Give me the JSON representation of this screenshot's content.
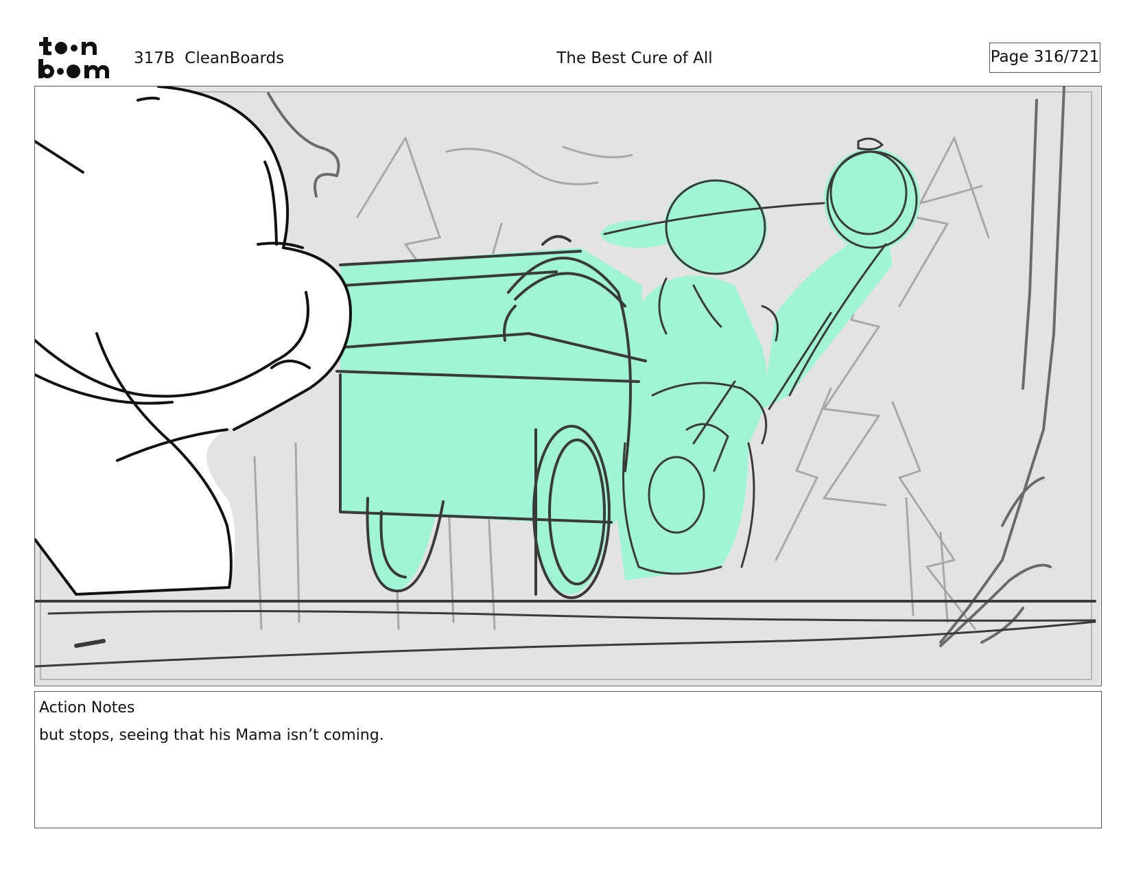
{
  "header": {
    "logo_text": "toon boom",
    "project_name": "317B  CleanBoards",
    "scene_title": "The Best Cure of All",
    "page_label": "Page 316/721"
  },
  "panel": {
    "description_icon": "storyboard-sketch"
  },
  "notes": {
    "heading": "Action Notes",
    "text": "but stops, seeing that his Mama isn’t coming."
  },
  "colors": {
    "sketch_fill": "#a0f5d6",
    "background_gray": "#e3e3e3",
    "line_dark": "#3a3a3a",
    "line_light": "#a8a8a8"
  }
}
